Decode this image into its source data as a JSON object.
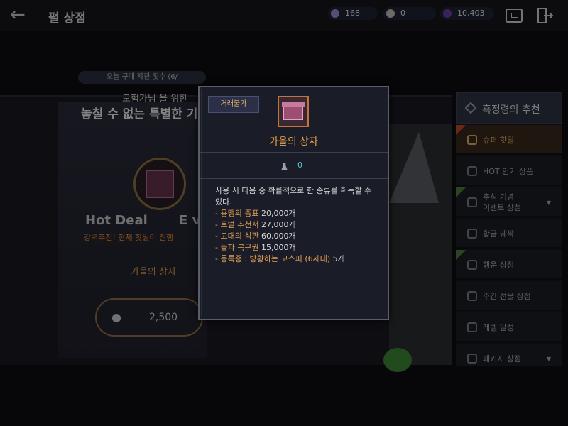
{
  "header": {
    "title": "펄 상점",
    "currencies": [
      {
        "icon": "mileage-coin-icon",
        "value": "168"
      },
      {
        "icon": "pearl-icon",
        "value": "0"
      },
      {
        "icon": "purple-gem-icon",
        "value": "10,403"
      }
    ]
  },
  "banner": {
    "limit_text": "오늘 구매 제한 횟수 (6/",
    "subtitle": "모험가님 을 위한",
    "headline": "놓칠 수 없는 특별한 기회!",
    "hot_deal": "Hot Deal",
    "ev_text": "E v",
    "recommend": "강력추천! 현재 핫딜이 진행",
    "item_name": "가을의 상자",
    "price": "2,500"
  },
  "sidebar": {
    "header": "흑정령의 추천",
    "items": [
      {
        "label": "슈퍼 핫딜",
        "active": true,
        "ribbon": "red"
      },
      {
        "label": "HOT 인기 상품",
        "active": false
      },
      {
        "label": "추석 기념\n이벤트 상점",
        "active": false,
        "ribbon": "green",
        "two_line": true,
        "arrow": "▼"
      },
      {
        "label": "황금 궤짝",
        "active": false
      },
      {
        "label": "행운 상점",
        "active": false,
        "ribbon": "green"
      },
      {
        "label": "주간 선물 상점",
        "active": false
      },
      {
        "label": "레벨 달성",
        "active": false
      },
      {
        "label": "패키지 상점",
        "active": false,
        "arrow": "▼"
      }
    ]
  },
  "popup": {
    "tag": "거래불가",
    "item_name": "가을의 상자",
    "owned_count": "0",
    "description": "사용 시 다음 중 확률적으로 한 종류를 획득할 수 있다.",
    "rewards": [
      {
        "name": "- 용맹의 증표",
        "count": " 20,000개"
      },
      {
        "name": "- 토벌 추천서",
        "count": " 27,000개"
      },
      {
        "name": "- 고대의 석판",
        "count": " 60,000개"
      },
      {
        "name": "- 돌파 복구권",
        "count": " 15,000개"
      },
      {
        "name": "- 등록증 : 방황하는 고스피 (6세대)",
        "count": " 5개",
        "special": true
      }
    ]
  },
  "colors": {
    "accent_orange": "#e8a247",
    "owned_cyan": "#5fc3cf",
    "popup_bg": "#1a1c28"
  }
}
